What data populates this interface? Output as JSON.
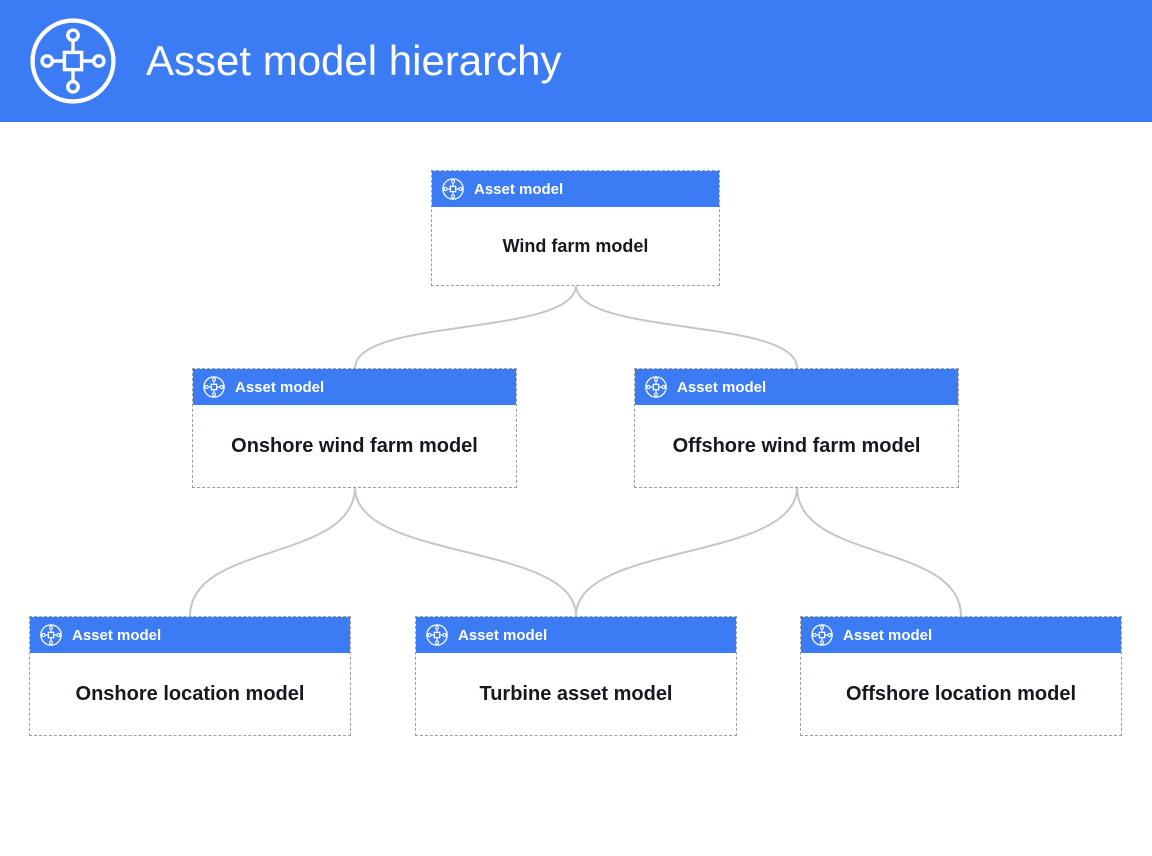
{
  "header": {
    "title": "Asset model hierarchy"
  },
  "node_type_label": "Asset model",
  "colors": {
    "accent": "#3B7CF5",
    "connector": "#c2c6cd",
    "text": "#16191f"
  },
  "nodes": {
    "root": {
      "type_label": "Asset model",
      "title": "Wind farm model"
    },
    "onshore": {
      "type_label": "Asset model",
      "title": "Onshore wind farm model"
    },
    "offshore": {
      "type_label": "Asset model",
      "title": "Offshore wind farm model"
    },
    "onshore_location": {
      "type_label": "Asset model",
      "title": "Onshore location model"
    },
    "turbine": {
      "type_label": "Asset model",
      "title": "Turbine asset model"
    },
    "offshore_location": {
      "type_label": "Asset model",
      "title": "Offshore location model"
    }
  },
  "hierarchy": {
    "root": "Wind farm model",
    "children": [
      {
        "name": "Onshore wind farm model",
        "children": [
          "Onshore location model",
          "Turbine asset model"
        ]
      },
      {
        "name": "Offshore wind farm model",
        "children": [
          "Turbine asset model",
          "Offshore location model"
        ]
      }
    ]
  }
}
